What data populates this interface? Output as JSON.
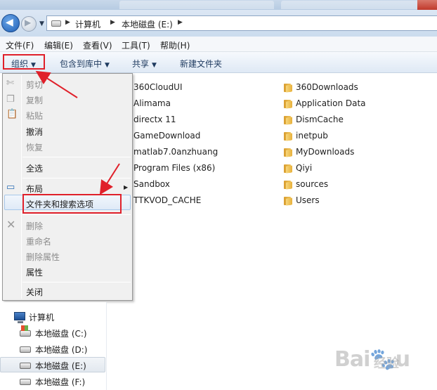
{
  "address": {
    "crumbs": [
      "计算机",
      "本地磁盘 (E:)"
    ]
  },
  "menubar": {
    "file": "文件(F)",
    "edit": "编辑(E)",
    "view": "查看(V)",
    "tools": "工具(T)",
    "help": "帮助(H)"
  },
  "toolbar": {
    "organize": "组织",
    "include": "包含到库中",
    "share": "共享",
    "new_folder": "新建文件夹"
  },
  "menu": {
    "cut": "剪切",
    "copy": "复制",
    "paste": "粘贴",
    "undo": "撤消",
    "redo": "恢复",
    "select_all": "全选",
    "layout": "布局",
    "folder_options": "文件夹和搜索选项",
    "delete": "删除",
    "rename": "重命名",
    "remove_props": "删除属性",
    "properties": "属性",
    "close": "关闭"
  },
  "files": {
    "col1": [
      "360CloudUI",
      "Alimama",
      "directx 11",
      "GameDownload",
      "matlab7.0anzhuang",
      "Program Files (x86)",
      "Sandbox",
      "TTKVOD_CACHE"
    ],
    "col2": [
      "360Downloads",
      "Application Data",
      "DismCache",
      "inetpub",
      "MyDownloads",
      "Qiyi",
      "sources",
      "Users"
    ]
  },
  "nav": {
    "computer": "计算机",
    "drives": [
      "本地磁盘 (C:)",
      "本地磁盘 (D:)",
      "本地磁盘 (E:)",
      "本地磁盘 (F:)"
    ]
  },
  "colors": {
    "highlight_box": "#e0202a",
    "folder": "#e8b13c"
  }
}
